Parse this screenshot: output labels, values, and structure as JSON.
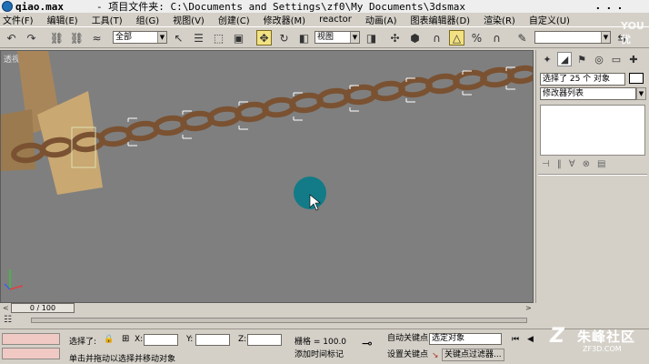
{
  "window": {
    "file_name": "qiao.max",
    "project_path": "- 项目文件夹: C:\\Documents and Settings\\zf0\\My Documents\\3dsmax",
    "overflow": ". . ."
  },
  "menu": [
    {
      "label": "文件(F)"
    },
    {
      "label": "编辑(E)"
    },
    {
      "label": "工具(T)"
    },
    {
      "label": "组(G)"
    },
    {
      "label": "视图(V)"
    },
    {
      "label": "创建(C)"
    },
    {
      "label": "修改器(M)"
    },
    {
      "label": "reactor"
    },
    {
      "label": "动画(A)"
    },
    {
      "label": "图表编辑器(D)"
    },
    {
      "label": "渲染(R)"
    },
    {
      "label": "自定义(U)"
    }
  ],
  "toolbar": {
    "selection_filter": "全部",
    "reference_coord": "视图",
    "named_selection": ""
  },
  "viewport": {
    "label": "透视"
  },
  "command_panel": {
    "selection_info": "选择了 25 个 对象",
    "modifier_list": "修改器列表"
  },
  "timeline": {
    "frame_display": "0 / 100",
    "prev_arrow": "<",
    "next_arrow": ">"
  },
  "status": {
    "selected_label": "选择了:",
    "x_label": "X:",
    "y_label": "Y:",
    "z_label": "Z:",
    "x_value": "",
    "y_value": "",
    "z_value": "",
    "grid_label": "栅格 = 100.0",
    "prompt": "单击并拖动以选择并移动对象",
    "add_time_tag": "添加时间标记",
    "auto_key": "自动关键点",
    "set_key": "设置关键点",
    "selection_set": "选定对象",
    "key_filters": "关键点过滤器..."
  },
  "watermark": {
    "brand": "朱峰社区",
    "url": "ZF3D.COM",
    "corner": "YOU 优"
  }
}
